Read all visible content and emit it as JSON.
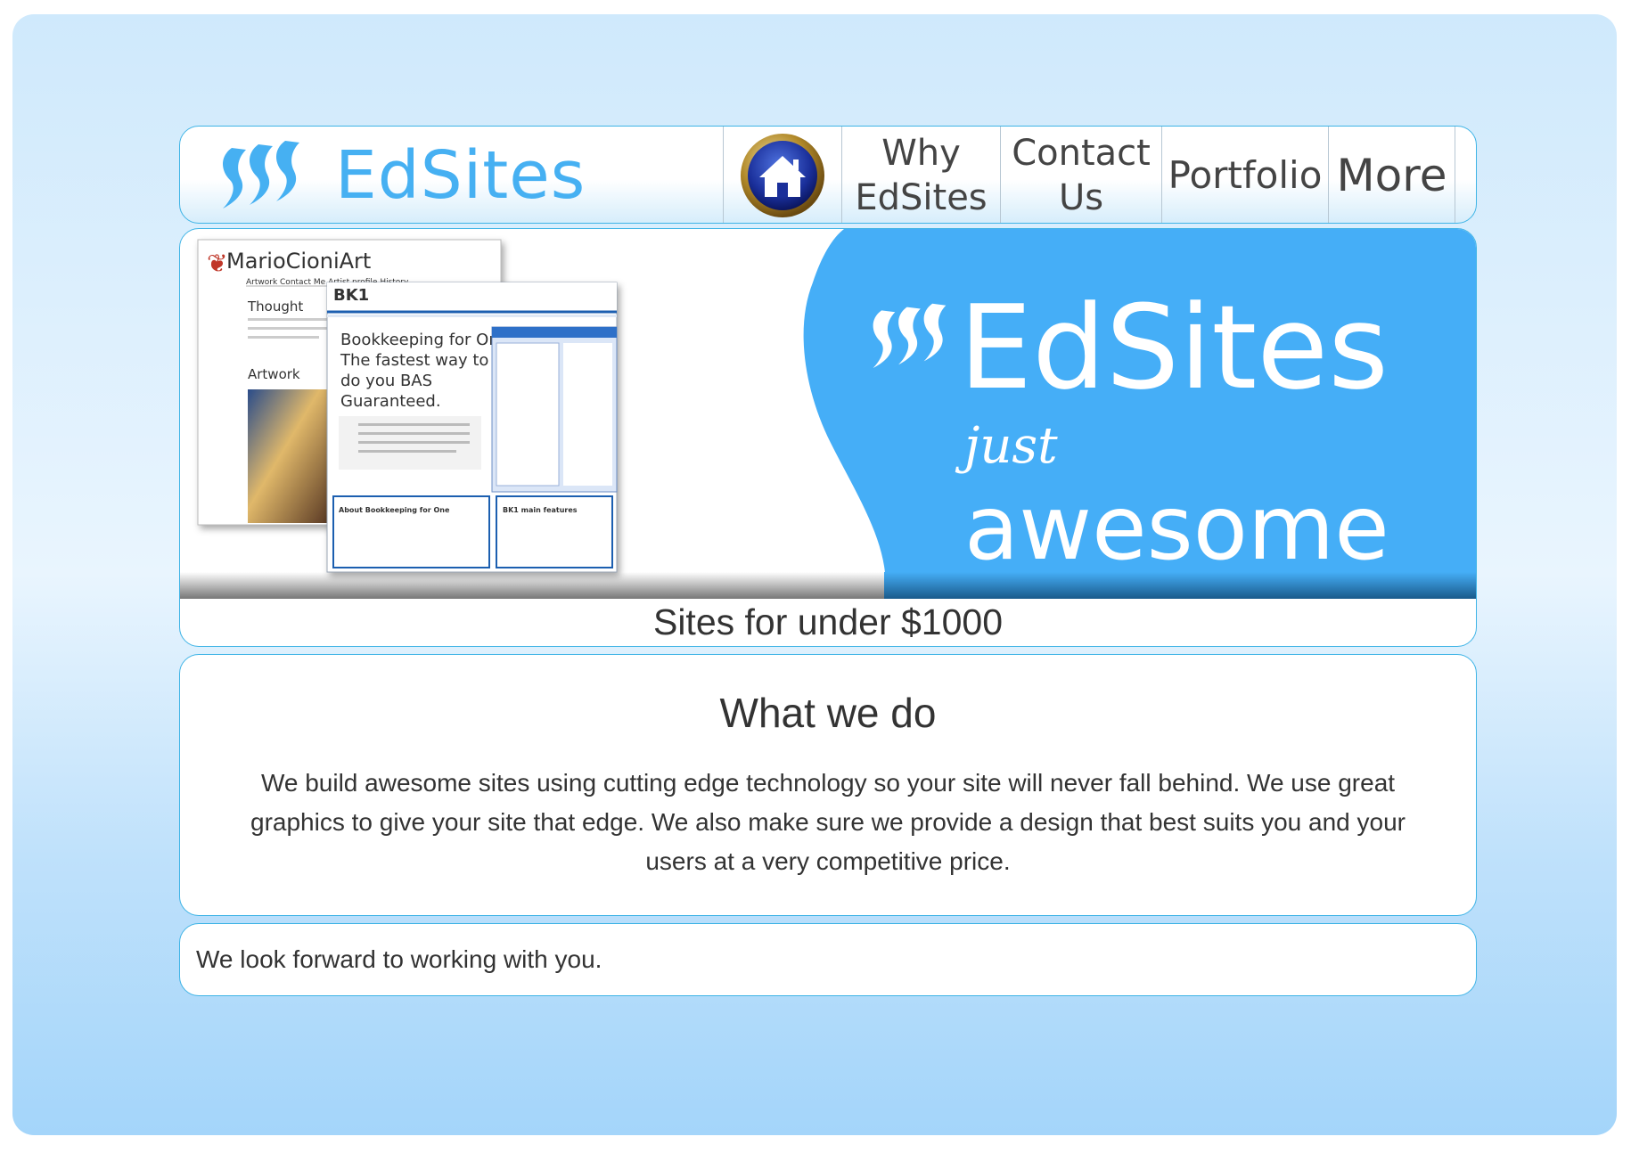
{
  "brand": {
    "name": "EdSites"
  },
  "nav": {
    "home_icon": "home-icon",
    "items": [
      {
        "label_line1": "Why",
        "label_line2": "EdSites"
      },
      {
        "label_line1": "Contact",
        "label_line2": "Us"
      },
      {
        "label_line1": "Portfolio"
      },
      {
        "label_line1": "More"
      }
    ]
  },
  "banner": {
    "headline": "EdSites",
    "tagline_small": "just",
    "tagline_big": "awesome",
    "caption": "Sites for under $1000",
    "screenshot_front": {
      "logo": "BK1",
      "lines": [
        "Bookkeeping for One",
        "The fastest way to",
        "do you BAS",
        "Guaranteed."
      ],
      "box1_title": "About Bookkeeping for One",
      "box2_title": "BK1 main features"
    },
    "screenshot_back": {
      "title": "MarioCioniArt",
      "nav": "Artwork  Contact Me  Artist profile  History",
      "heading1": "Thought",
      "heading2": "Artwork"
    },
    "accent_color": "#45aef7"
  },
  "content": {
    "heading": "What we do",
    "body": "We build awesome sites using cutting edge technology so your site will never fall behind. We use great graphics to give your site that edge. We also make sure we provide a design that best suits you and your users at a very competitive price."
  },
  "closing": {
    "text": "We look forward to working with you."
  }
}
